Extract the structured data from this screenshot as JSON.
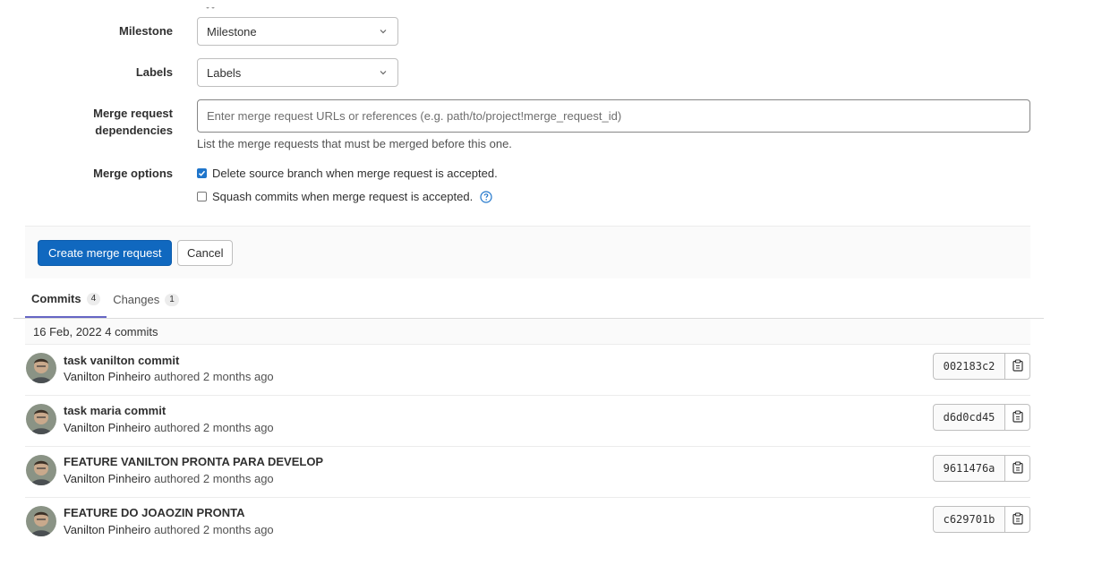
{
  "form": {
    "milestone": {
      "label": "Milestone",
      "value": "Milestone"
    },
    "labels": {
      "label": "Labels",
      "value": "Labels"
    },
    "dependencies": {
      "label_line1": "Merge request",
      "label_line2": "dependencies",
      "placeholder": "Enter merge request URLs or references (e.g. path/to/project!merge_request_id)",
      "help": "List the merge requests that must be merged before this one."
    },
    "merge_options": {
      "label": "Merge options",
      "delete_source": {
        "text": "Delete source branch when merge request is accepted.",
        "checked": true
      },
      "squash": {
        "text": "Squash commits when merge request is accepted.",
        "checked": false
      }
    }
  },
  "actions": {
    "create_label": "Create merge request",
    "cancel_label": "Cancel"
  },
  "tabs": [
    {
      "label": "Commits",
      "count": "4"
    },
    {
      "label": "Changes",
      "count": "1"
    }
  ],
  "commits_day": "16 Feb, 2022 4 commits",
  "commits": [
    {
      "title": "task vanilton commit",
      "author": "Vanilton Pinheiro",
      "meta": "authored 2 months ago",
      "sha": "002183c2"
    },
    {
      "title": "task maria commit",
      "author": "Vanilton Pinheiro",
      "meta": "authored 2 months ago",
      "sha": "d6d0cd45"
    },
    {
      "title": "FEATURE VANILTON PRONTA PARA DEVELOP",
      "author": "Vanilton Pinheiro",
      "meta": "authored 2 months ago",
      "sha": "9611476a"
    },
    {
      "title": "FEATURE DO JOAOZIN PRONTA",
      "author": "Vanilton Pinheiro",
      "meta": "authored 2 months ago",
      "sha": "c629701b"
    }
  ],
  "colors": {
    "primary": "#1068bf",
    "tab_underline": "#6666c4",
    "help_icon": "#1f75cb"
  }
}
